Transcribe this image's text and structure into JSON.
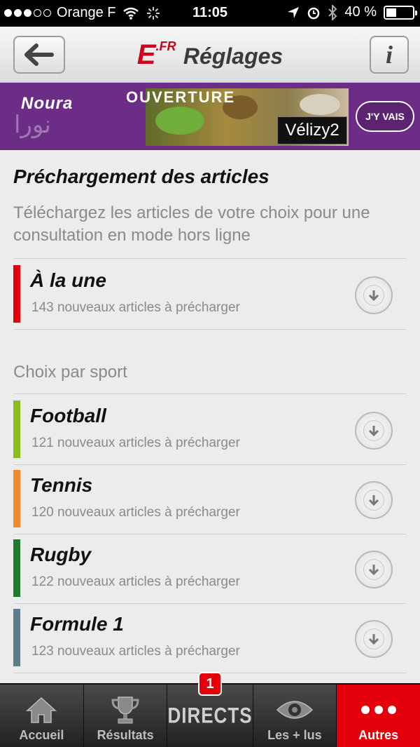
{
  "status_bar": {
    "carrier": "Orange F",
    "time": "11:05",
    "battery_text": "40 %",
    "battery_level": 0.4
  },
  "header": {
    "logo": "E",
    "logo_suffix": ".FR",
    "title": "Réglages",
    "back_icon": "arrow-left-icon",
    "info_label": "i"
  },
  "banner": {
    "brand": "Noura",
    "headline": "OUVERTURE",
    "location": "Vélizy2",
    "cta": "J'Y VAIS"
  },
  "preload": {
    "title": "Préchargement des articles",
    "description": "Téléchargez les articles de votre choix pour une consultation en mode hors ligne",
    "headline_item": {
      "name": "À la une",
      "count": "143 nouveaux articles à précharger",
      "color": "#e3000b"
    }
  },
  "sports": {
    "subtitle": "Choix par sport",
    "items": [
      {
        "name": "Football",
        "count": "121 nouveaux articles à précharger",
        "color": "#8cbd1e"
      },
      {
        "name": "Tennis",
        "count": "120 nouveaux articles à précharger",
        "color": "#ef8a2c"
      },
      {
        "name": "Rugby",
        "count": "122 nouveaux articles à précharger",
        "color": "#1e7a2c"
      },
      {
        "name": "Formule 1",
        "count": "123 nouveaux articles à précharger",
        "color": "#5c7d8c"
      }
    ]
  },
  "tabbar": {
    "tabs": [
      {
        "label": "Accueil",
        "icon": "home-icon"
      },
      {
        "label": "Résultats",
        "icon": "trophy-icon"
      },
      {
        "label": "DIRECTS",
        "badge": "1"
      },
      {
        "label": "Les + lus",
        "icon": "eye-icon"
      },
      {
        "label": "Autres",
        "icon": "more-dots-icon",
        "active": true
      }
    ],
    "active_color": "#e3000b"
  }
}
